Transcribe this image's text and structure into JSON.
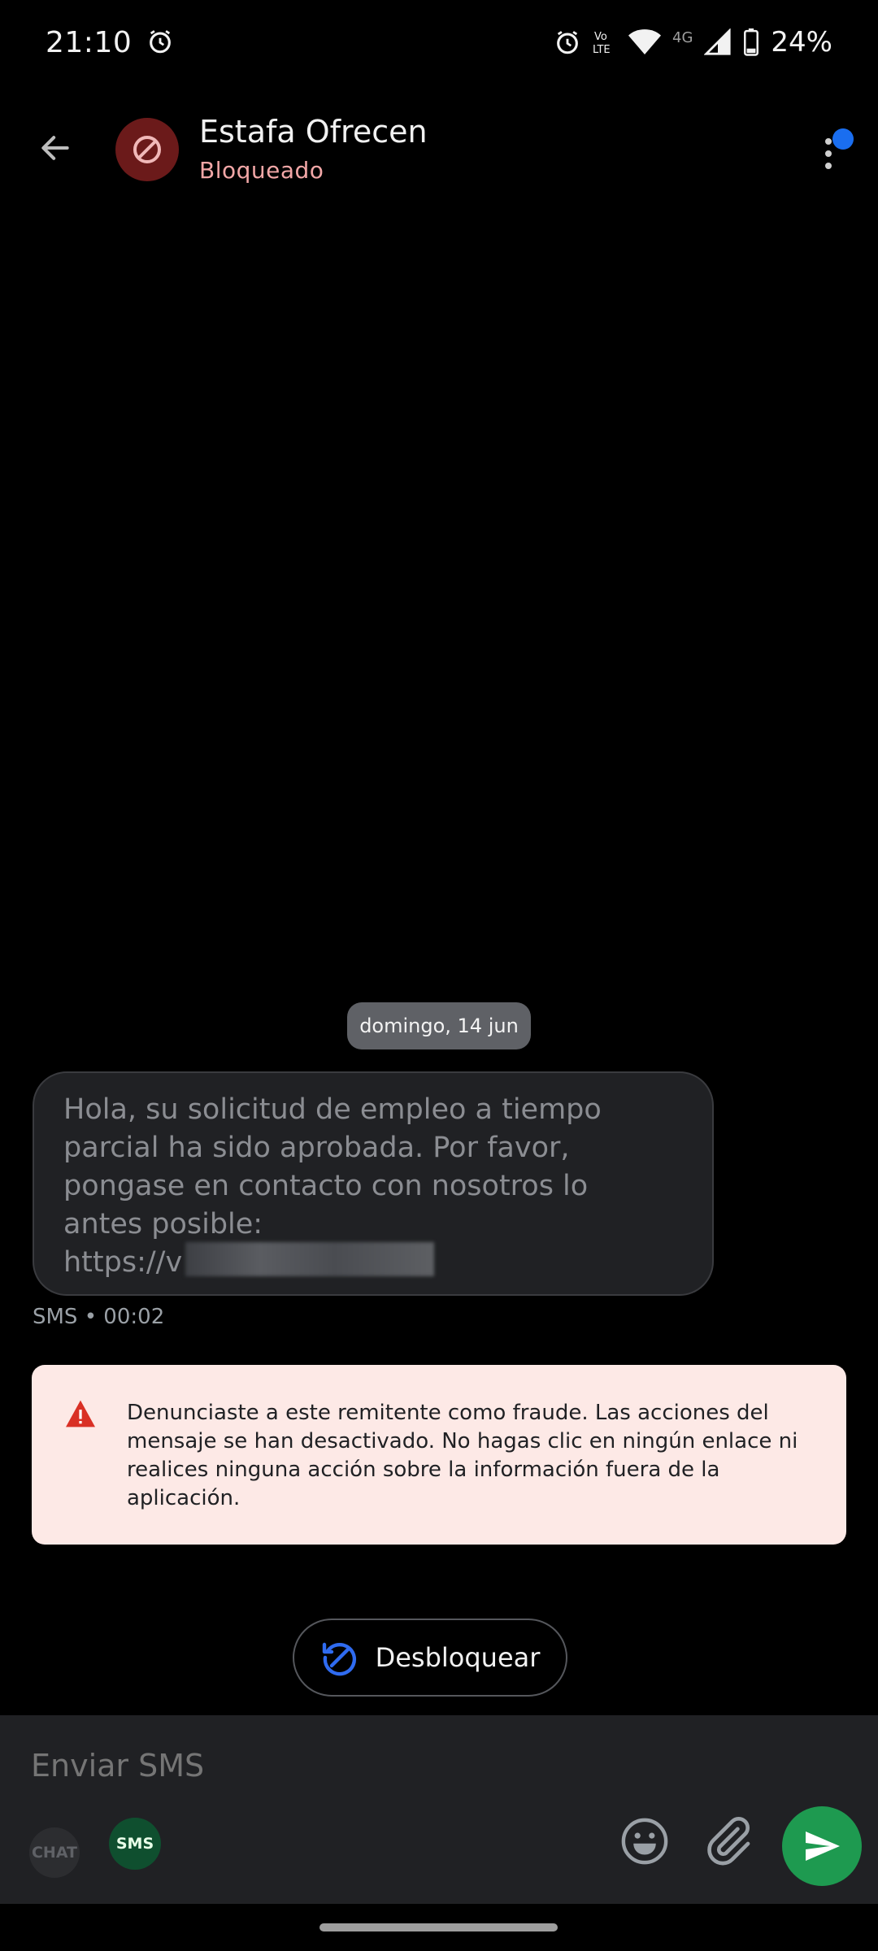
{
  "status_bar": {
    "time": "21:10",
    "network": "4G",
    "battery": "24%",
    "icons": [
      "alarm-icon",
      "volte-icon",
      "wifi-icon",
      "signal-icon",
      "battery-icon"
    ]
  },
  "header": {
    "contact_name": "Estafa Ofrecen",
    "contact_status": "Bloqueado",
    "avatar_icon": "blocked-icon",
    "notification_color": "#1a6ef0"
  },
  "conversation": {
    "date_chip": "domingo, 14 jun",
    "message": {
      "text": "Hola, su solicitud de empleo a tiempo\nparcial ha sido aprobada. Por favor,\npongase en contacto con nosotros lo\nantes posible:\nhttps://v                        36601",
      "meta": "SMS • 00:02"
    },
    "warning": {
      "text": "Denunciaste a este remitente como fraude. Las acciones del mensaje se han desactivado. No hagas clic en ningún enlace ni realices ninguna acción sobre la información fuera de la aplicación.",
      "color": "#fde9e6"
    },
    "unblock_label": "Desbloquear"
  },
  "compose": {
    "placeholder": "Enviar SMS",
    "mode_chat": "CHAT",
    "mode_sms": "SMS",
    "send_color": "#1e9a50"
  }
}
